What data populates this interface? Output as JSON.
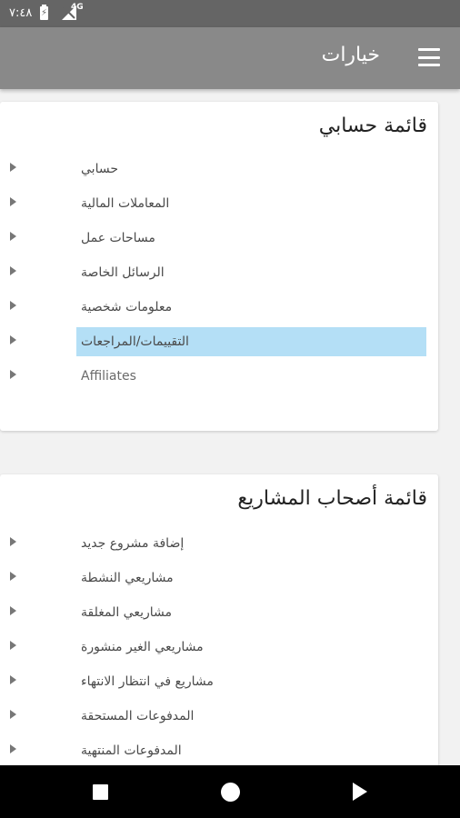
{
  "status_bar": {
    "time": "٧:٤٨",
    "network": "4G",
    "icons": [
      "battery-charging-icon",
      "signal-icon"
    ]
  },
  "app_bar": {
    "title": "خيارات",
    "menu_icon": "hamburger-menu-icon"
  },
  "account_menu": {
    "title": "قائمة حسابي",
    "items": [
      {
        "label": "حسابي"
      },
      {
        "label": "المعاملات المالية"
      },
      {
        "label": "مساحات عمل"
      },
      {
        "label": "الرسائل الخاصة"
      },
      {
        "label": "معلومات شخصية"
      },
      {
        "label": "التقييمات/المراجعات",
        "selected": true
      },
      {
        "label": "Affiliates"
      }
    ]
  },
  "owners_menu": {
    "title": "قائمة أصحاب المشاريع",
    "items": [
      {
        "label": "إضافة مشروع جديد"
      },
      {
        "label": "مشاريعي النشطة"
      },
      {
        "label": "مشاريعي المغلقة"
      },
      {
        "label": "مشاريعي الغير منشورة"
      },
      {
        "label": "مشاريع في انتظار الانتهاء"
      },
      {
        "label": "المدفوعات المستحقة"
      },
      {
        "label": "المدفوعات المنتهية"
      }
    ]
  },
  "nav_bar": {
    "icons": [
      "back-square-icon",
      "home-circle-icon",
      "recent-triangle-icon"
    ]
  },
  "colors": {
    "status_bar": "#656565",
    "app_bar": "#898989",
    "selected_item": "#b4dff6",
    "background": "#f2f2f2"
  }
}
